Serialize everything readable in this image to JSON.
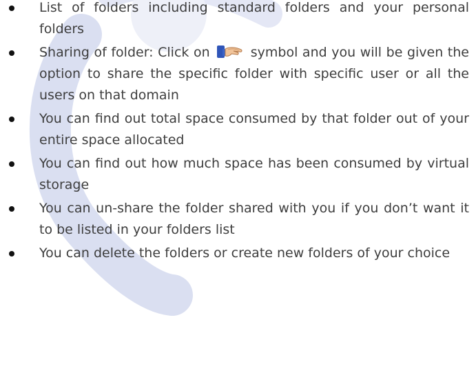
{
  "bullets": [
    {
      "text": "List of folders  including standard folders and your personal folders"
    },
    {
      "before": "Sharing of folder: Click on",
      "icon": "share-hand-icon",
      "after": "symbol and you will be given the option to share the specific folder with specific user or all the users on that domain"
    },
    {
      "text": "You can find out total space consumed by that folder out of your entire space allocated"
    },
    {
      "text": "You can find out how much space has been consumed by virtual storage"
    },
    {
      "text": "You can un-share the folder shared with you if you don’t want it to be listed in your folders list"
    },
    {
      "text": "You can delete the folders or create new folders of your choice"
    }
  ],
  "colors": {
    "text": "#3d3d3d",
    "watermark": "#d7dcf0",
    "icon_sleeve": "#2f55b8",
    "icon_hand": "#f1c49a"
  }
}
